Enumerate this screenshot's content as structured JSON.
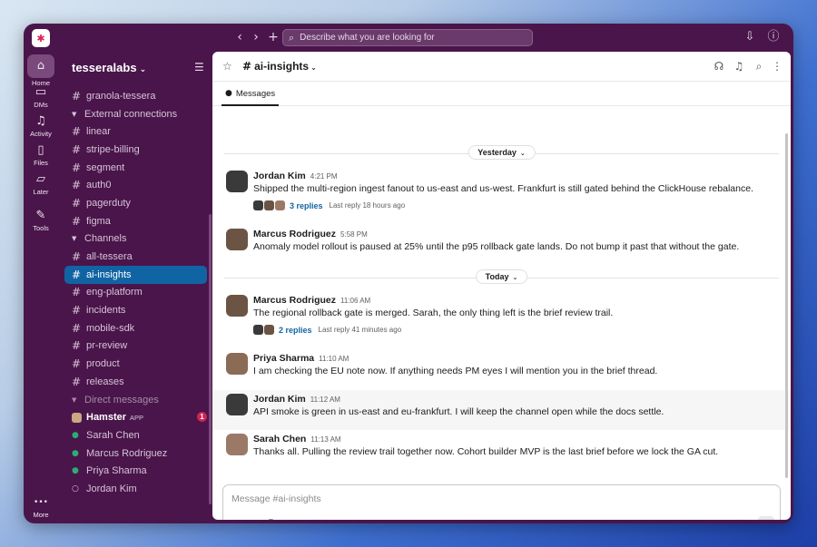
{
  "app": {
    "search_placeholder": "Describe what you are looking for",
    "icons": {
      "back": "chevron-left-icon",
      "forward": "chevron-right-icon",
      "new": "plus-icon"
    }
  },
  "rail": [
    {
      "id": "home",
      "label": "Home",
      "icon": "⌂",
      "active": true
    },
    {
      "id": "dms",
      "label": "DMs",
      "icon": "▭",
      "active": false
    },
    {
      "id": "activity",
      "label": "Activity",
      "icon": "♫",
      "active": false
    },
    {
      "id": "files",
      "label": "Files",
      "icon": "▯",
      "active": false
    },
    {
      "id": "later",
      "label": "Later",
      "icon": "▱",
      "active": false
    },
    {
      "id": "tools",
      "label": "Tools",
      "icon": "✎",
      "active": false
    },
    {
      "id": "more",
      "label": "More",
      "icon": "•••",
      "active": false
    }
  ],
  "sidebar": {
    "workspace": "tesseralabs",
    "items": [
      {
        "type": "channel",
        "label": "granola-tessera"
      },
      {
        "type": "section",
        "label": "External connections"
      },
      {
        "type": "channel",
        "label": "linear"
      },
      {
        "type": "channel",
        "label": "stripe-billing"
      },
      {
        "type": "channel",
        "label": "segment"
      },
      {
        "type": "channel",
        "label": "auth0"
      },
      {
        "type": "channel",
        "label": "pagerduty"
      },
      {
        "type": "channel",
        "label": "figma"
      },
      {
        "type": "section",
        "label": "Channels"
      },
      {
        "type": "channel",
        "label": "all-tessera"
      },
      {
        "type": "channel",
        "label": "ai-insights",
        "active": true
      },
      {
        "type": "channel",
        "label": "eng-platform"
      },
      {
        "type": "channel",
        "label": "incidents"
      },
      {
        "type": "channel",
        "label": "mobile-sdk"
      },
      {
        "type": "channel",
        "label": "pr-review"
      },
      {
        "type": "channel",
        "label": "product"
      },
      {
        "type": "channel",
        "label": "releases"
      },
      {
        "type": "section",
        "label": "Direct messages",
        "muted": true
      },
      {
        "type": "dm-app",
        "label": "Hamster",
        "app": "APP",
        "badge": "1"
      },
      {
        "type": "dm",
        "label": "Sarah Chen",
        "online": true
      },
      {
        "type": "dm",
        "label": "Marcus Rodriguez",
        "online": true
      },
      {
        "type": "dm",
        "label": "Priya Sharma",
        "online": true
      },
      {
        "type": "dm",
        "label": "Jordan Kim",
        "online": false
      }
    ]
  },
  "channel": {
    "name": "ai-insights",
    "tab": "Messages",
    "dividers": {
      "yesterday": "Yesterday",
      "today": "Today"
    },
    "messages": [
      {
        "author": "Jordan Kim",
        "time": "4:21 PM",
        "text": "Shipped the multi-region ingest fanout to us-east and us-west. Frankfurt is still gated behind the ClickHouse rebalance.",
        "replies": "3 replies",
        "last_reply": "Last reply 18 hours ago"
      },
      {
        "author": "Marcus Rodriguez",
        "time": "5:58 PM",
        "text": "Anomaly model rollout is paused at 25% until the p95 rollback gate lands. Do not bump it past that without the gate."
      },
      {
        "author": "Marcus Rodriguez",
        "time": "11:06 AM",
        "text": "The regional rollback gate is merged. Sarah, the only thing left is the brief review trail.",
        "replies": "2 replies",
        "last_reply": "Last reply 41 minutes ago"
      },
      {
        "author": "Priya Sharma",
        "time": "11:10 AM",
        "text": "I am checking the EU note now. If anything needs PM eyes I will mention you in the brief thread."
      },
      {
        "author": "Jordan Kim",
        "time": "11:12 AM",
        "text": "API smoke is green in us-east and eu-frankfurt. I will keep the channel open while the docs settle."
      },
      {
        "author": "Sarah Chen",
        "time": "11:13 AM",
        "text": "Thanks all. Pulling the review trail together now. Cohort builder MVP is the last brief before we lock the GA cut."
      }
    ]
  },
  "composer": {
    "placeholder": "Message #ai-insights",
    "format_label": "Aa"
  },
  "colors": {
    "aubergine": "#4a154b",
    "active_channel": "#1164a3",
    "presence": "#2bac76",
    "badge": "#cd2553",
    "link": "#1264a3"
  }
}
